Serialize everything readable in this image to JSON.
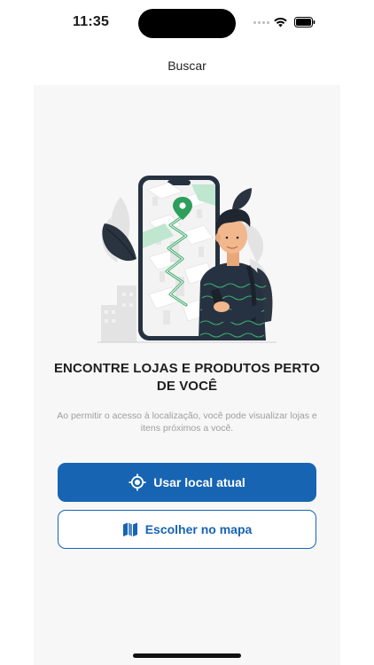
{
  "status": {
    "time": "11:35"
  },
  "nav": {
    "title": "Buscar"
  },
  "location_prompt": {
    "heading": "ENCONTRE LOJAS E PRODUTOS PERTO DE VOCÊ",
    "description": "Ao permitir o acesso à localização, você pode visualizar lojas e itens próximos a você.",
    "primary_button": {
      "label": "Usar local atual",
      "icon": "location-target-icon"
    },
    "secondary_button": {
      "label": "Escolher no mapa",
      "icon": "map-icon"
    }
  },
  "colors": {
    "primary": "#1764B3",
    "map_accent": "#3DAA6A",
    "card_background": "#F7F7F7"
  }
}
